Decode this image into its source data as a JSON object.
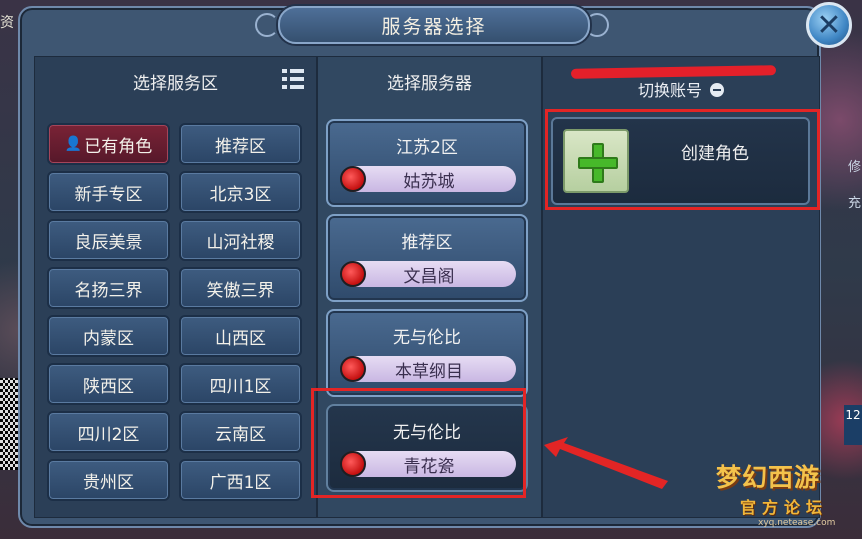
{
  "window": {
    "title": "服务器选择",
    "close_icon": "close-icon"
  },
  "zone_panel": {
    "header": "选择服务区",
    "list_icon": "list-icon",
    "zones": [
      {
        "label": "已有角色",
        "active": true,
        "icon": "person-icon"
      },
      {
        "label": "推荐区",
        "active": false
      },
      {
        "label": "新手专区",
        "active": false
      },
      {
        "label": "北京3区",
        "active": false
      },
      {
        "label": "良辰美景",
        "active": false
      },
      {
        "label": "山河社稷",
        "active": false
      },
      {
        "label": "名扬三界",
        "active": false
      },
      {
        "label": "笑傲三界",
        "active": false
      },
      {
        "label": "内蒙区",
        "active": false
      },
      {
        "label": "山西区",
        "active": false
      },
      {
        "label": "陕西区",
        "active": false
      },
      {
        "label": "四川1区",
        "active": false
      },
      {
        "label": "四川2区",
        "active": false
      },
      {
        "label": "云南区",
        "active": false
      },
      {
        "label": "贵州区",
        "active": false
      },
      {
        "label": "广西1区",
        "active": false
      }
    ]
  },
  "server_panel": {
    "header": "选择服务器",
    "servers": [
      {
        "region": "江苏2区",
        "name": "姑苏城",
        "status_color": "#d01515"
      },
      {
        "region": "推荐区",
        "name": "文昌阁",
        "status_color": "#d01515"
      },
      {
        "region": "无与伦比",
        "name": "本草纲目",
        "status_color": "#d01515"
      },
      {
        "region": "无与伦比",
        "name": "青花瓷",
        "status_color": "#d01515",
        "selected": true
      }
    ]
  },
  "account_panel": {
    "switch_account": "切换账号",
    "create_role": "创建角色"
  },
  "background": {
    "left_edge_text": "资",
    "right_edge_text": [
      "修",
      "充"
    ],
    "right_badge": "12"
  },
  "watermark": {
    "logo": "梦幻西游",
    "subtitle": "官方论坛",
    "url": "xyq.netease.com"
  },
  "colors": {
    "annotation_red": "#e32525",
    "active_zone": "#7a2336",
    "panel_bg": "#2b3f57"
  }
}
